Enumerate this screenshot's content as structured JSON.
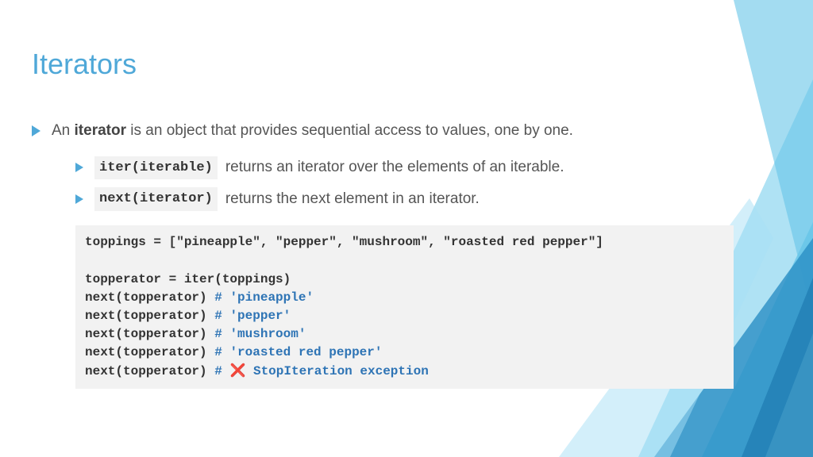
{
  "title": "Iterators",
  "intro_pre": "An ",
  "intro_bold": "iterator",
  "intro_post": " is an object that provides sequential access to values, one by one.",
  "sub1_code": "iter(iterable)",
  "sub1_text": "returns an iterator over the elements of an iterable.",
  "sub2_code": "next(iterator)",
  "sub2_text": "returns the next element in an iterator.",
  "code": {
    "l1": "toppings = [\"pineapple\", \"pepper\", \"mushroom\", \"roasted red pepper\"]",
    "l2": "topperator = iter(toppings)",
    "l3a": "next(topperator)  ",
    "l3c": "# 'pineapple'",
    "l4a": "next(topperator)  ",
    "l4c": "# 'pepper'",
    "l5a": "next(topperator)  ",
    "l5c": "# 'mushroom'",
    "l6a": "next(topperator)  ",
    "l6c": "# 'roasted red pepper'",
    "l7a": "next(topperator)  ",
    "l7c1": "# ",
    "l7x": "❌",
    "l7c2": " StopIteration exception"
  }
}
